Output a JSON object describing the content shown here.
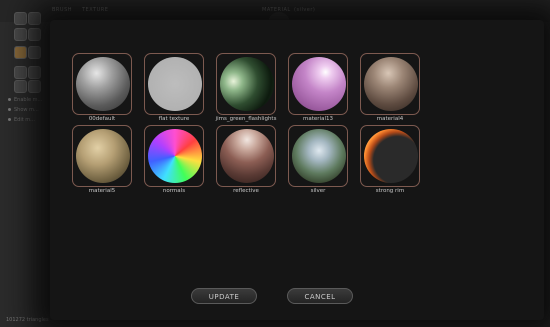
{
  "background_app": {
    "tabs": [
      "BRUSH",
      "TEXTURE",
      "MATERIAL"
    ],
    "material_value": "(silver)",
    "side_items": [
      "Enable m...",
      "Show m...",
      "Edit m..."
    ],
    "status": "101272 triangles"
  },
  "materials": [
    {
      "name": "00default",
      "icon": "matcap-default-sphere"
    },
    {
      "name": "flat texture",
      "icon": "matcap-flat-sphere"
    },
    {
      "name": "jims_green_flashlights",
      "icon": "matcap-green-sphere"
    },
    {
      "name": "material13",
      "icon": "matcap-purple-sphere"
    },
    {
      "name": "material4",
      "icon": "matcap-brown-sphere"
    },
    {
      "name": "material5",
      "icon": "matcap-tan-sphere"
    },
    {
      "name": "normals",
      "icon": "matcap-normals-sphere"
    },
    {
      "name": "reflective",
      "icon": "matcap-reflective-sphere"
    },
    {
      "name": "silver",
      "icon": "matcap-silver-sphere"
    },
    {
      "name": "strong rim",
      "icon": "matcap-rim-sphere"
    }
  ],
  "buttons": {
    "update": "UPDATE",
    "cancel": "CANCEL"
  },
  "colors": {
    "thumb_border": "#7d5a50",
    "modal_bg": "#151515"
  }
}
